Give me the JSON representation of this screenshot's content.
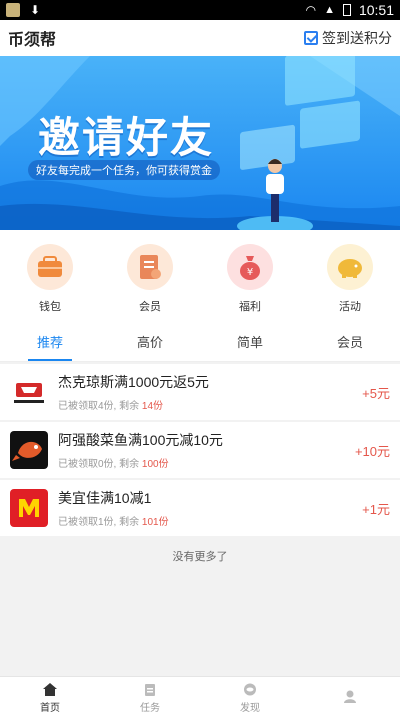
{
  "statusbar": {
    "time": "10:51"
  },
  "header": {
    "title": "币须帮",
    "signin_label": "签到送积分"
  },
  "banner": {
    "title": "邀请好友",
    "subtitle": "好友每完成一个任务，你可获得赏金"
  },
  "quick": [
    {
      "label": "钱包",
      "icon": "wallet-icon",
      "bg": "#fde8d8",
      "color": "#f08a3c"
    },
    {
      "label": "会员",
      "icon": "member-card-icon",
      "bg": "#fde8d8",
      "color": "#e9875a"
    },
    {
      "label": "福利",
      "icon": "money-bag-icon",
      "bg": "#fde0e0",
      "color": "#e65a5a"
    },
    {
      "label": "活动",
      "icon": "piggy-bank-icon",
      "bg": "#fdf1d3",
      "color": "#f0b93a"
    }
  ],
  "tabs": [
    "推荐",
    "高价",
    "简单",
    "会员"
  ],
  "list": [
    {
      "title": "杰克琼斯满1000元返5元",
      "claimed": "已被领取4份, 剩余",
      "remain": "14份",
      "reward": "+5元",
      "logo": "jack-jones-logo"
    },
    {
      "title": "阿强酸菜鱼满100元减10元",
      "claimed": "已被领取0份, 剩余",
      "remain": "100份",
      "reward": "+10元",
      "logo": "aqiang-fish-logo"
    },
    {
      "title": "美宜佳满10减1",
      "claimed": "已被领取1份, 剩余",
      "remain": "101份",
      "reward": "+1元",
      "logo": "meiyijia-logo"
    }
  ],
  "no_more": "没有更多了",
  "bottomnav": [
    {
      "label": "首页",
      "icon": "home-icon"
    },
    {
      "label": "任务",
      "icon": "task-icon"
    },
    {
      "label": "发现",
      "icon": "discover-icon"
    },
    {
      "label": "",
      "icon": "profile-icon"
    }
  ],
  "colors": {
    "accent": "#1a86f0",
    "reward": "#e4574b"
  }
}
